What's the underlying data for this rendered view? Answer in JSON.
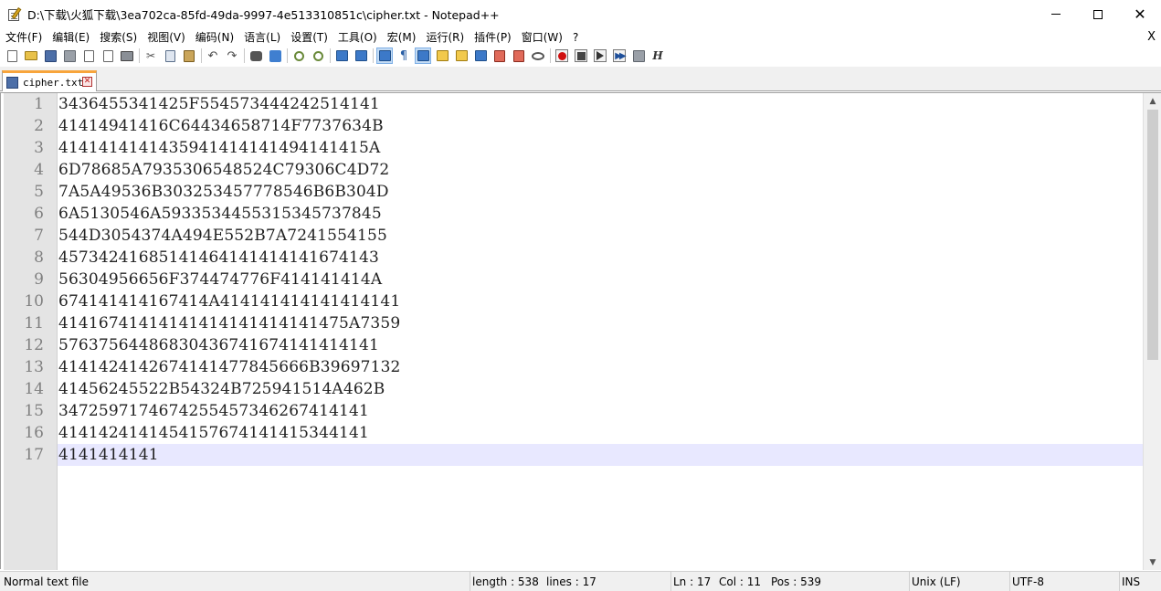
{
  "window": {
    "title": "D:\\下载\\火狐下载\\3ea702ca-85fd-49da-9997-4e513310851c\\cipher.txt - Notepad++",
    "close_glyph": "✕"
  },
  "menu": {
    "items": [
      "文件(F)",
      "编辑(E)",
      "搜索(S)",
      "视图(V)",
      "编码(N)",
      "语言(L)",
      "设置(T)",
      "工具(O)",
      "宏(M)",
      "运行(R)",
      "插件(P)",
      "窗口(W)",
      "?"
    ],
    "close_label": "X"
  },
  "toolbar": {
    "macro_label": "H"
  },
  "tab": {
    "label": "cipher.txt",
    "close_glyph": "✕"
  },
  "editor": {
    "current_line": 17,
    "lines": [
      "3436455341425F554573444242514141",
      "41414941416C64434658714F7737634B",
      "4141414141435941414141494141415A",
      "6D78685A7935306548524C79306C4D72",
      "7A5A49536B303253457778546B6B304D",
      "6A5130546A5933534455315345737845",
      "544D3054374A494E552B7A7241554155",
      "45734241685141464141414141674143",
      "56304956656F374474776F414141414A",
      "674141414167414A414141414141414141",
      "41416741414141414141414141475A7359",
      "57637564486830436741674141414141",
      "4141424142674141477845666B39697132",
      "41456245522B54324B725941514A462B",
      "3472597174674255457346267414141",
      "4141424141454157674141415344141",
      "4141414141"
    ]
  },
  "status": {
    "file_type": "Normal text file",
    "length": "length : 538",
    "lines": "lines : 17",
    "ln": "Ln : 17",
    "col": "Col : 11",
    "pos": "Pos : 539",
    "eol": "Unix (LF)",
    "encoding": "UTF-8",
    "mode": "INS"
  },
  "colors": {
    "current_line_bg": "#e8e8ff",
    "tab_accent": "#f8a53c",
    "gutter_bg": "#e4e4e4",
    "line_number": "#808080"
  }
}
